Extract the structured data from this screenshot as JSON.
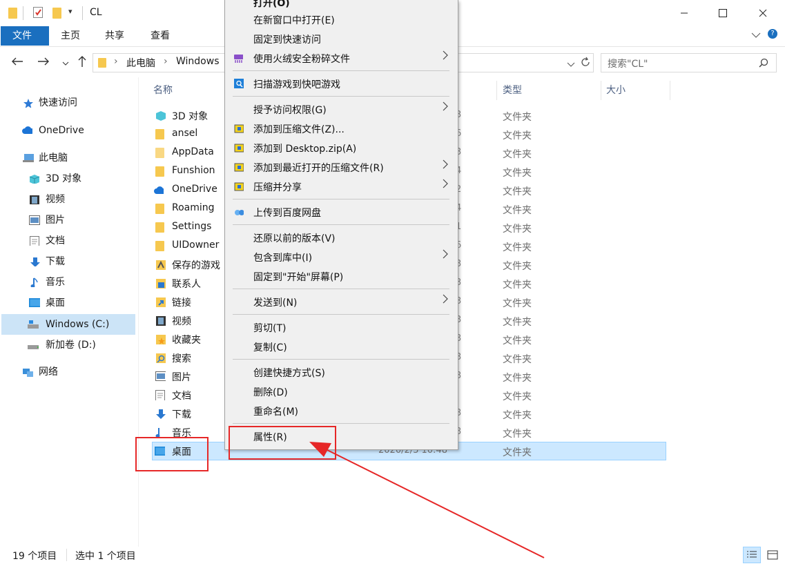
{
  "window": {
    "title": "CL",
    "quick_access_chevron": "▾",
    "minimize_icon": "minimize-icon",
    "maximize_icon": "maximize-icon",
    "close_icon": "close-icon"
  },
  "ribbon": {
    "tabs": [
      "文件",
      "主页",
      "共享",
      "查看"
    ],
    "accent": "#1a6fbf",
    "expand_icon": "chevron-down-icon"
  },
  "address": {
    "back_icon": "back-arrow-icon",
    "forward_icon": "forward-arrow-icon",
    "recent_icon": "chevron-down-icon",
    "up_icon": "up-arrow-icon",
    "breadcrumb": [
      "此电脑",
      "Windows"
    ],
    "breadcrumb_sep": "›",
    "search_placeholder": "搜索\"CL\""
  },
  "sidebar": {
    "items": [
      {
        "label": "快速访问",
        "icon": "star-icon"
      },
      {
        "label": "OneDrive",
        "icon": "cloud-icon"
      },
      {
        "label": "此电脑",
        "icon": "computer-icon"
      },
      {
        "label": "3D 对象",
        "icon": "cube-icon"
      },
      {
        "label": "视频",
        "icon": "film-icon"
      },
      {
        "label": "图片",
        "icon": "picture-icon"
      },
      {
        "label": "文档",
        "icon": "document-icon"
      },
      {
        "label": "下载",
        "icon": "download-icon"
      },
      {
        "label": "音乐",
        "icon": "music-icon"
      },
      {
        "label": "桌面",
        "icon": "desktop-icon"
      },
      {
        "label": "Windows (C:)",
        "icon": "drive-icon",
        "selected": true
      },
      {
        "label": "新加卷 (D:)",
        "icon": "drive-icon"
      },
      {
        "label": "网络",
        "icon": "network-icon"
      }
    ]
  },
  "columns": {
    "name": "名称",
    "type": "类型",
    "size": "大小"
  },
  "files": [
    {
      "name": "3D 对象",
      "date_tail": "3",
      "type": "文件夹",
      "icon": "cube-icon"
    },
    {
      "name": "ansel",
      "date_tail": "6",
      "type": "文件夹",
      "icon": "folder-icon"
    },
    {
      "name": "AppData",
      "date_tail": "3",
      "type": "文件夹",
      "icon": "folder-icon"
    },
    {
      "name": "Funshion",
      "date_tail": "4",
      "type": "文件夹",
      "icon": "folder-icon"
    },
    {
      "name": "OneDrive",
      "date_tail": "2",
      "type": "文件夹",
      "icon": "cloud-icon"
    },
    {
      "name": "Roaming",
      "date_tail": "4",
      "type": "文件夹",
      "icon": "folder-icon"
    },
    {
      "name": "Settings",
      "date_tail": "1",
      "type": "文件夹",
      "icon": "folder-icon"
    },
    {
      "name": "UIDowner",
      "date_tail": "6",
      "type": "文件夹",
      "icon": "folder-icon"
    },
    {
      "name": "保存的游戏",
      "date_tail": "3",
      "type": "文件夹",
      "icon": "game-icon"
    },
    {
      "name": "联系人",
      "date_tail": "3",
      "type": "文件夹",
      "icon": "contacts-icon"
    },
    {
      "name": "链接",
      "date_tail": "3",
      "type": "文件夹",
      "icon": "link-icon"
    },
    {
      "name": "视频",
      "date_tail": "3",
      "type": "文件夹",
      "icon": "film-icon"
    },
    {
      "name": "收藏夹",
      "date_tail": "3",
      "type": "文件夹",
      "icon": "favorites-icon"
    },
    {
      "name": "搜索",
      "date_tail": "3",
      "type": "文件夹",
      "icon": "search-folder-icon"
    },
    {
      "name": "图片",
      "date_tail": "3",
      "type": "文件夹",
      "icon": "picture-icon"
    },
    {
      "name": "文档",
      "date_tail": "",
      "type": "文件夹",
      "icon": "document-icon"
    },
    {
      "name": "下载",
      "date_tail": "3",
      "type": "文件夹",
      "icon": "download-icon"
    },
    {
      "name": "音乐",
      "date_tail": "3",
      "type": "文件夹",
      "icon": "music-icon"
    },
    {
      "name": "桌面",
      "date": "2020/2/3 10:48",
      "type": "文件夹",
      "icon": "desktop-icon",
      "selected": true
    }
  ],
  "context_menu": {
    "items": [
      {
        "label": "打开(O)",
        "icon": "",
        "submenu": false
      },
      {
        "label": "在新窗口中打开(E)",
        "icon": "",
        "submenu": false
      },
      {
        "label": "固定到快速访问",
        "icon": "",
        "submenu": false
      },
      {
        "label": "使用火绒安全粉碎文件",
        "icon": "shredder-icon",
        "submenu": true
      },
      {
        "label": "扫描游戏到快吧游戏",
        "icon": "scan-icon",
        "submenu": false
      },
      {
        "label": "授予访问权限(G)",
        "icon": "",
        "submenu": true
      },
      {
        "label": "添加到压缩文件(Z)...",
        "icon": "archive-icon",
        "submenu": false
      },
      {
        "label": "添加到 Desktop.zip(A)",
        "icon": "archive-icon",
        "submenu": false
      },
      {
        "label": "添加到最近打开的压缩文件(R)",
        "icon": "archive-icon",
        "submenu": true
      },
      {
        "label": "压缩并分享",
        "icon": "archive-icon",
        "submenu": true
      },
      {
        "label": "上传到百度网盘",
        "icon": "baidu-cloud-icon",
        "submenu": false
      },
      {
        "label": "还原以前的版本(V)",
        "icon": "",
        "submenu": false
      },
      {
        "label": "包含到库中(I)",
        "icon": "",
        "submenu": true
      },
      {
        "label": "固定到\"开始\"屏幕(P)",
        "icon": "",
        "submenu": false
      },
      {
        "label": "发送到(N)",
        "icon": "",
        "submenu": true
      },
      {
        "label": "剪切(T)",
        "icon": "",
        "submenu": false
      },
      {
        "label": "复制(C)",
        "icon": "",
        "submenu": false
      },
      {
        "label": "创建快捷方式(S)",
        "icon": "",
        "submenu": false
      },
      {
        "label": "删除(D)",
        "icon": "",
        "submenu": false
      },
      {
        "label": "重命名(M)",
        "icon": "",
        "submenu": false
      },
      {
        "label": "属性(R)",
        "icon": "",
        "submenu": false
      }
    ],
    "submenu_arrow": "›"
  },
  "status": {
    "count": "19 个项目",
    "selected": "选中 1 个项目",
    "details_view_icon": "details-view-icon",
    "large_icons_view_icon": "large-icons-view-icon"
  },
  "annotation": {
    "highlight_color": "#e62727"
  }
}
